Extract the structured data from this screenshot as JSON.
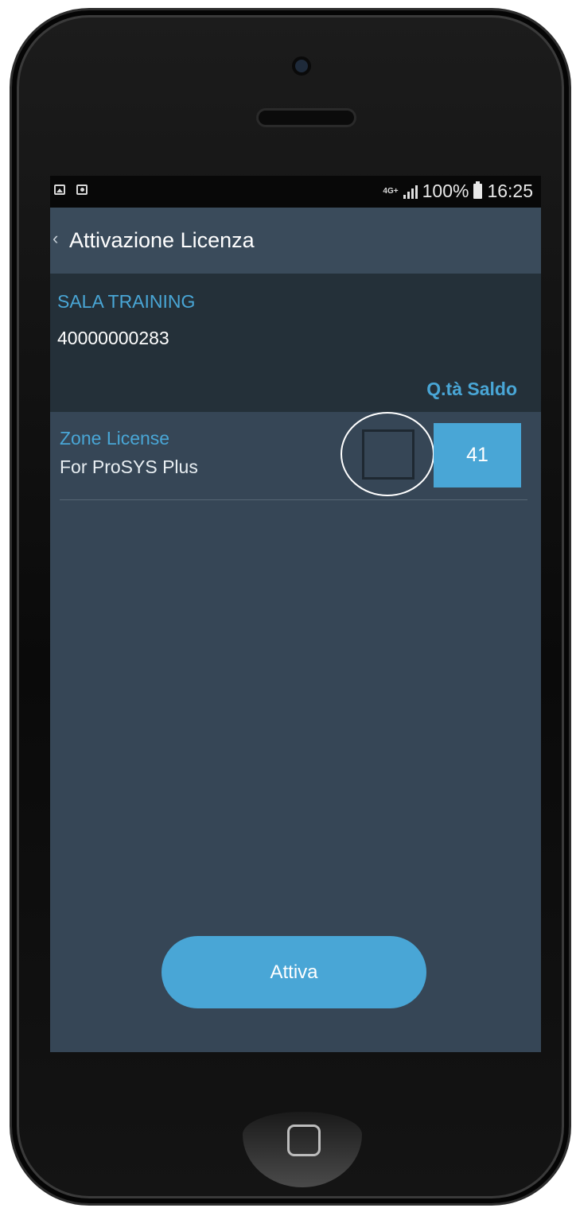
{
  "status_bar": {
    "network": "4G+",
    "battery": "100%",
    "time": "16:25",
    "icons": [
      "gallery-icon",
      "screenshot-icon",
      "signal-icon",
      "battery-icon"
    ]
  },
  "app_bar": {
    "back_icon": "‹",
    "title": "Attivazione Licenza"
  },
  "site": {
    "name": "SALA TRAINING",
    "code": "40000000283",
    "column_header": "Q.tà Saldo"
  },
  "licenses": [
    {
      "name": "Zone License",
      "description": "For ProSYS Plus",
      "checked": false,
      "quantity": "41"
    }
  ],
  "actions": {
    "activate_label": "Attiva"
  },
  "colors": {
    "accent": "#49a6d6",
    "screen_bg": "#364656",
    "header_bg": "#243039"
  }
}
